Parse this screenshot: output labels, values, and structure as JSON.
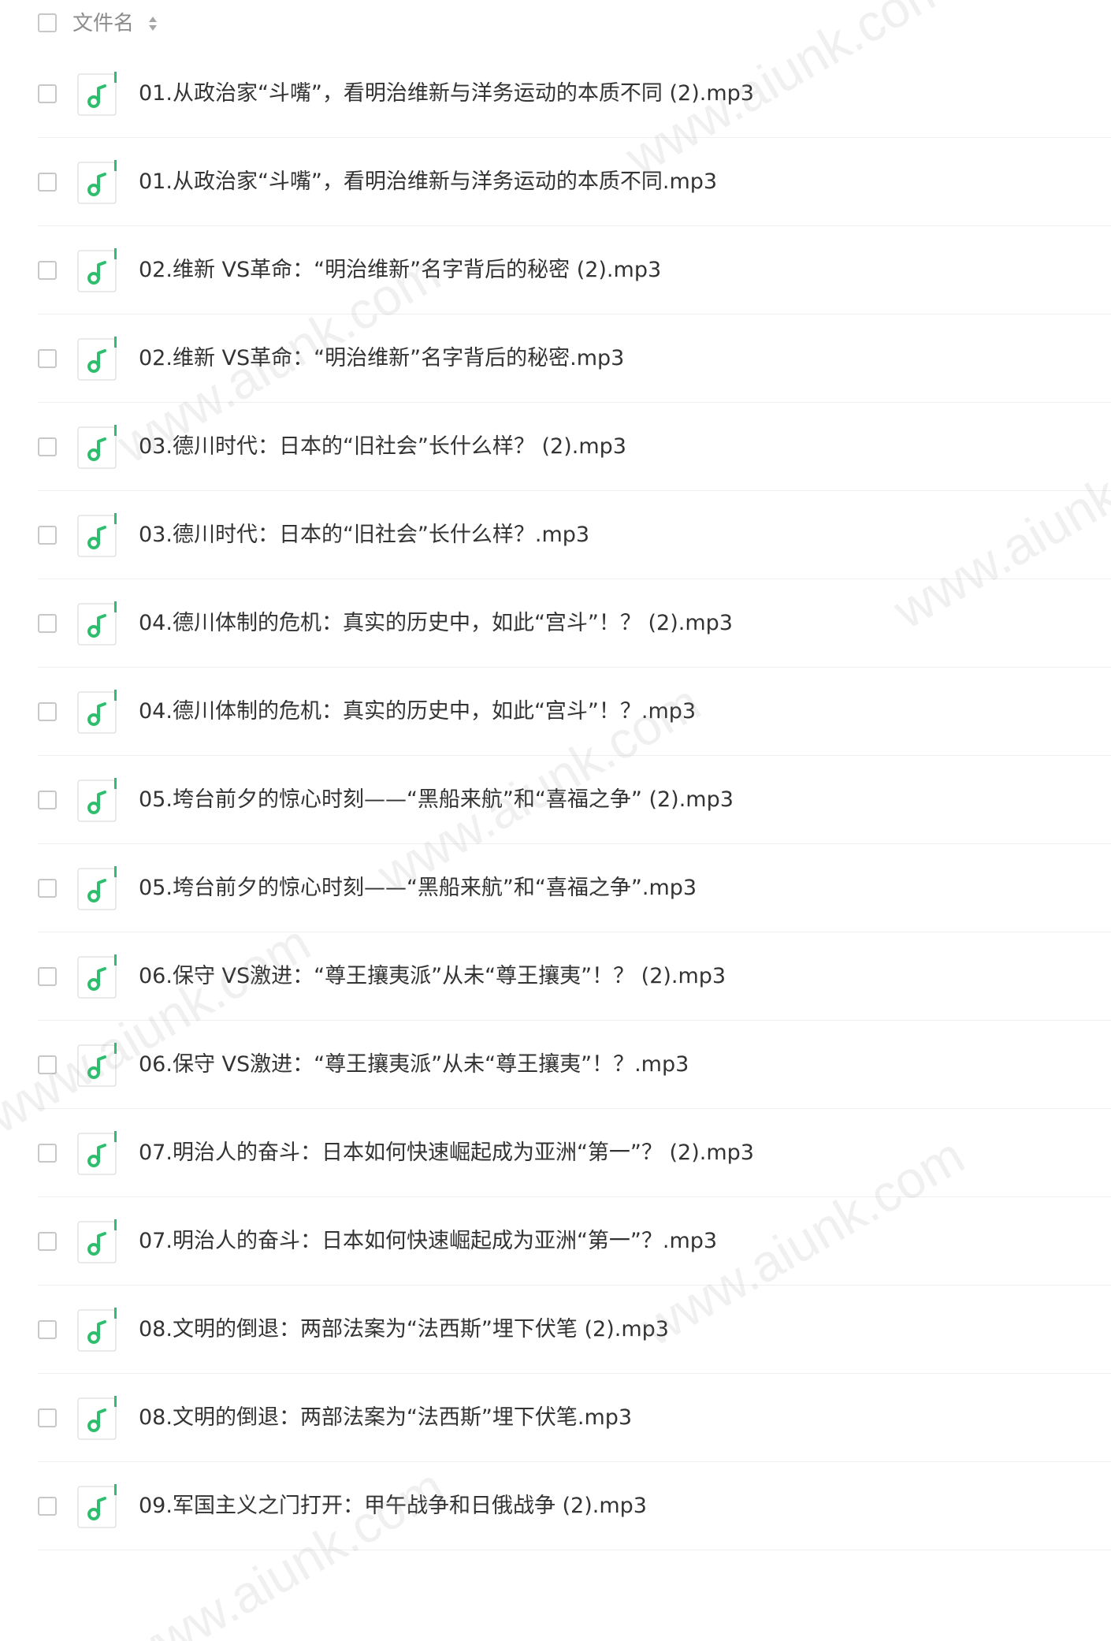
{
  "header": {
    "column_label": "文件名"
  },
  "files": [
    {
      "name": "01.从政治家“斗嘴”，看明治维新与洋务运动的本质不同 (2).mp3",
      "icon": "music-note-icon"
    },
    {
      "name": "01.从政治家“斗嘴”，看明治维新与洋务运动的本质不同.mp3",
      "icon": "music-note-icon"
    },
    {
      "name": "02.维新 VS革命：“明治维新”名字背后的秘密 (2).mp3",
      "icon": "music-note-icon"
    },
    {
      "name": "02.维新 VS革命：“明治维新”名字背后的秘密.mp3",
      "icon": "music-note-icon"
    },
    {
      "name": "03.德川时代：日本的“旧社会”长什么样？ (2).mp3",
      "icon": "music-note-icon"
    },
    {
      "name": "03.德川时代：日本的“旧社会”长什么样？.mp3",
      "icon": "music-note-icon"
    },
    {
      "name": "04.德川体制的危机：真实的历史中，如此“宫斗”！？ (2).mp3",
      "icon": "music-note-icon"
    },
    {
      "name": "04.德川体制的危机：真实的历史中，如此“宫斗”！？.mp3",
      "icon": "music-note-icon"
    },
    {
      "name": "05.垮台前夕的惊心时刻——“黑船来航”和“喜福之争” (2).mp3",
      "icon": "music-note-icon"
    },
    {
      "name": "05.垮台前夕的惊心时刻——“黑船来航”和“喜福之争”.mp3",
      "icon": "music-note-icon"
    },
    {
      "name": "06.保守 VS激进：“尊王攘夷派”从未“尊王攘夷”！？ (2).mp3",
      "icon": "music-note-icon"
    },
    {
      "name": "06.保守 VS激进：“尊王攘夷派”从未“尊王攘夷”！？.mp3",
      "icon": "music-note-icon"
    },
    {
      "name": "07.明治人的奋斗：日本如何快速崛起成为亚洲“第一”？ (2).mp3",
      "icon": "music-note-icon"
    },
    {
      "name": "07.明治人的奋斗：日本如何快速崛起成为亚洲“第一”？.mp3",
      "icon": "music-note-icon"
    },
    {
      "name": "08.文明的倒退：两部法案为“法西斯”埋下伏笔 (2).mp3",
      "icon": "music-note-icon"
    },
    {
      "name": "08.文明的倒退：两部法案为“法西斯”埋下伏笔.mp3",
      "icon": "music-note-icon"
    },
    {
      "name": "09.军国主义之门打开：甲午战争和日俄战争 (2).mp3",
      "icon": "music-note-icon"
    }
  ],
  "watermarks": [
    "www.aiunk.com",
    "www.aiunk.com",
    "www.aiunk.com",
    "www.aiunk.com",
    "www.aiunk.com",
    "www.aiunk.com",
    "www.aiunk.com"
  ],
  "colors": {
    "icon_green": "#2fbe6e",
    "text": "#333333",
    "header_text": "#8c8c8c",
    "checkbox_border": "#c8c8c8",
    "divider": "#eeeeee"
  }
}
